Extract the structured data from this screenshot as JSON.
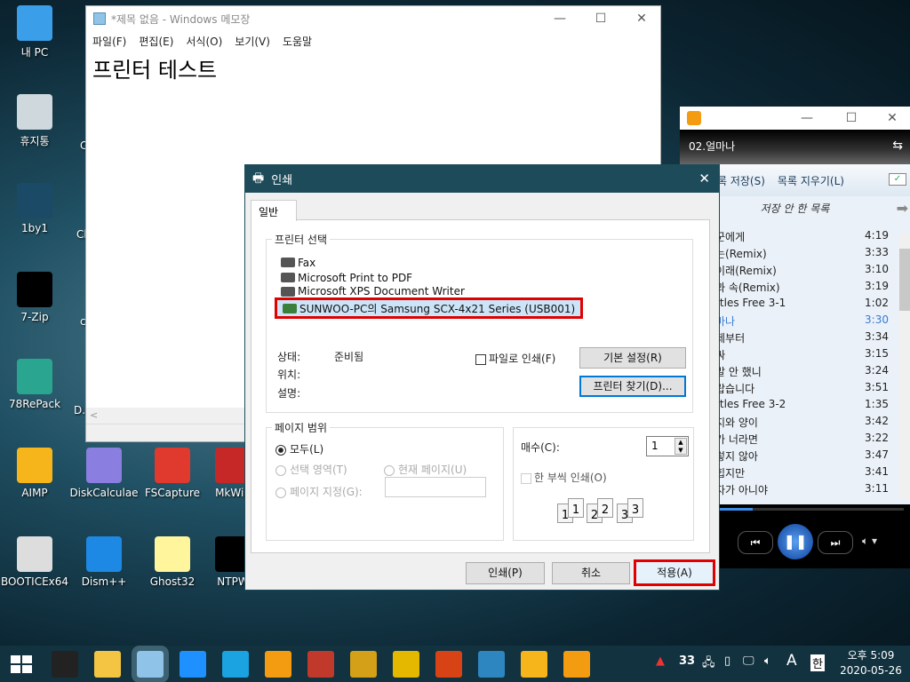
{
  "desktop": {
    "icons": [
      {
        "label": "내 PC",
        "icon": "computer-icon",
        "color": "#3a9ee8"
      },
      {
        "label": "휴지통",
        "icon": "recycle-bin-icon",
        "color": "#cfd8dc"
      },
      {
        "label": "1by1",
        "icon": "1by1-icon",
        "color": "#1b4a66"
      },
      {
        "label": "7-Zip",
        "icon": "7zip-icon",
        "color": "#000000"
      },
      {
        "label": "78RePack",
        "icon": "78repack-icon",
        "color": "#2aa58f"
      },
      {
        "label": "AIMP",
        "icon": "aimp-icon",
        "color": "#f7b51c"
      },
      {
        "label": "BOOTICEx64",
        "icon": "floppy-icon",
        "color": "#dddddd"
      },
      {
        "label": "DiskCalculae",
        "icon": "disk-chart-icon",
        "color": "#8a7ee0"
      },
      {
        "label": "FSCapture",
        "icon": "fscapture-icon",
        "color": "#e03a2e"
      },
      {
        "label": "MkWin",
        "icon": "mkwin-icon",
        "color": "#c62828"
      },
      {
        "label": "Dism++",
        "icon": "gears-icon",
        "color": "#1e88e5"
      },
      {
        "label": "Ghost32",
        "icon": "ghost-icon",
        "color": "#fff59d"
      },
      {
        "label": "NTPW",
        "icon": "ntpw-icon",
        "color": "#000000"
      }
    ],
    "partial_labels": [
      "C",
      "Cl",
      "c",
      "D."
    ]
  },
  "notepad": {
    "title": "*제목 없음 - Windows 메모장",
    "menu": [
      "파일(F)",
      "편집(E)",
      "서식(O)",
      "보기(V)",
      "도움말"
    ],
    "content": "프린터 테스트",
    "scroll_left": "<"
  },
  "player": {
    "now_playing": "02.얼마나",
    "toolbar": [
      "록 저장(S)",
      "목록 지우기(L)"
    ],
    "list_title": "저장 안 한 목록",
    "tracks": [
      {
        "title": "군에게",
        "duration": "4:19"
      },
      {
        "title": "는(Remix)",
        "duration": "3:33"
      },
      {
        "title": "이래(Remix)",
        "duration": "3:10"
      },
      {
        "title": "과 속(Remix)",
        "duration": "3:19"
      },
      {
        "title": "rtles Free 3-1",
        "duration": "1:02"
      },
      {
        "title": "마나",
        "duration": "3:30",
        "playing": true
      },
      {
        "title": "제부터",
        "duration": "3:34"
      },
      {
        "title": "싸",
        "duration": "3:15"
      },
      {
        "title": "말 안 했니",
        "duration": "3:24"
      },
      {
        "title": "랍습니다",
        "duration": "3:51"
      },
      {
        "title": "rtles Free 3-2",
        "duration": "1:35"
      },
      {
        "title": "지와 양이",
        "duration": "3:42"
      },
      {
        "title": "가 너라면",
        "duration": "3:22"
      },
      {
        "title": "렇지 않아",
        "duration": "3:47"
      },
      {
        "title": "힙지만",
        "duration": "3:41"
      },
      {
        "title": "자가 아니야",
        "duration": "3:11"
      }
    ],
    "progress_percent": 20,
    "accent": "#3a7bd5"
  },
  "print_dialog": {
    "title": "인쇄",
    "tab": "일반",
    "printer_group": "프린터 선택",
    "printers": [
      "Fax",
      "Microsoft Print to PDF",
      "Microsoft XPS Document Writer",
      "SUNWOO-PC의 Samsung SCX-4x21 Series (USB001)"
    ],
    "selected_printer": "SUNWOO-PC의 Samsung SCX-4x21 Series (USB001)",
    "status_label": "상태:",
    "status_value": "준비됨",
    "location_label": "위치:",
    "comment_label": "설명:",
    "print_to_file": "파일로 인쇄(F)",
    "preferences_button": "기본 설정(R)",
    "find_printer_button": "프린터 찾기(D)...",
    "page_range_group": "페이지 범위",
    "range_all": "모두(L)",
    "range_selection": "선택 영역(T)",
    "range_current": "현재 페이지(U)",
    "range_pages": "페이지 지정(G):",
    "range_pages_value": "",
    "copies_label": "매수(C):",
    "copies_value": "1",
    "collate": "한 부씩 인쇄(O)",
    "collate_pages": [
      "1",
      "1",
      "2",
      "2",
      "3",
      "3"
    ],
    "print_button": "인쇄(P)",
    "cancel_button": "취소",
    "apply_button": "적용(A)",
    "highlight_color": "#e00000",
    "title_color": "#1e4b5a"
  },
  "taskbar": {
    "apps": [
      "ntpw",
      "file-explorer",
      "notepad",
      "internet-explorer",
      "edge",
      "media-player",
      "app-red",
      "app-r",
      "sunflower",
      "app-disk",
      "app-screen",
      "aimp",
      "potplayer"
    ],
    "tray_badge": "33",
    "ime_mode": "A",
    "ime_lang": "한",
    "time": "오후 5:09",
    "date": "2020-05-26"
  }
}
